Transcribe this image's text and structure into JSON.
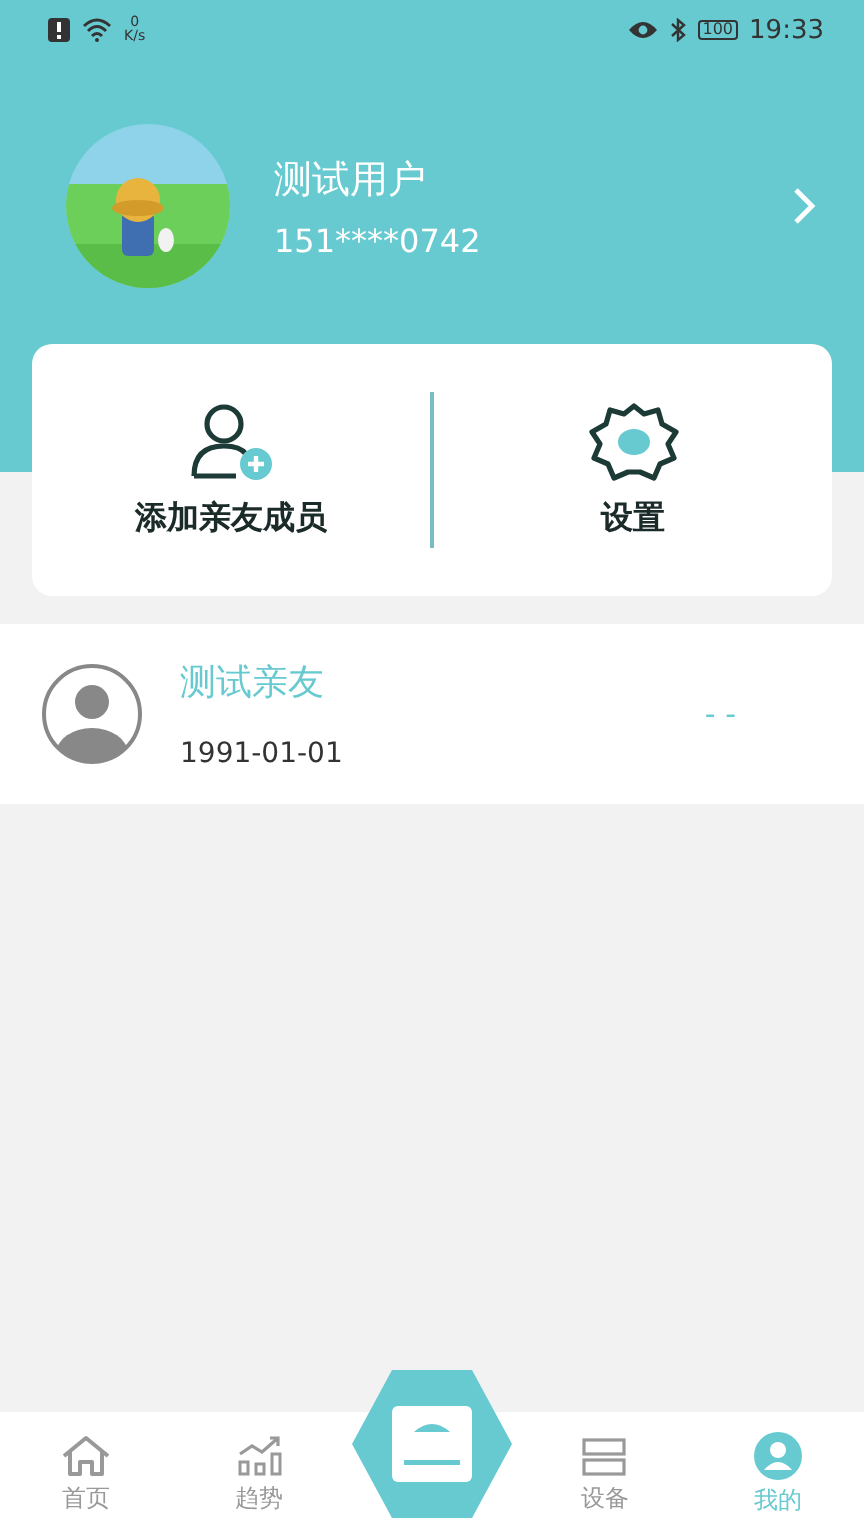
{
  "status_bar": {
    "net_speed": "0",
    "net_unit": "K/s",
    "battery": "100",
    "time": "19:33"
  },
  "profile": {
    "name": "测试用户",
    "phone": "151****0742"
  },
  "actions": [
    {
      "kind": "add-member",
      "label": "添加亲友成员"
    },
    {
      "kind": "settings",
      "label": "设置"
    }
  ],
  "members": [
    {
      "name": "测试亲友",
      "birthday": "1991-01-01",
      "reading": "- -"
    }
  ],
  "tabs": [
    {
      "kind": "home",
      "label": "首页",
      "selected": false
    },
    {
      "kind": "trend",
      "label": "趋势",
      "selected": false
    },
    {
      "kind": "scale",
      "selected": false
    },
    {
      "kind": "device",
      "label": "设备",
      "selected": false
    },
    {
      "kind": "me",
      "label": "我的",
      "selected": true
    }
  ]
}
